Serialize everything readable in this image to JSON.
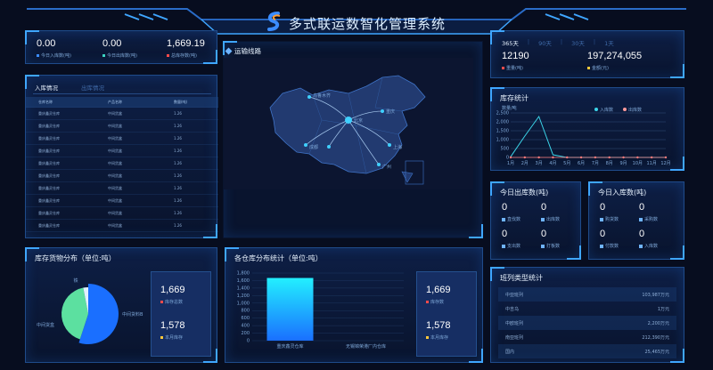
{
  "header": {
    "title": "多式联运数智化管理系统"
  },
  "top_stats": [
    {
      "value": "0.00",
      "label": "今日入库数(吨)",
      "color": "#3b8cff"
    },
    {
      "value": "0.00",
      "label": "今日出库数(吨)",
      "color": "#3bd4c2"
    },
    {
      "value": "1,669.19",
      "label": "总库存数(吨)",
      "color": "#ff4b4b"
    }
  ],
  "inbound": {
    "tabs": [
      "入库情况",
      "出库情况"
    ],
    "headers": [
      "仓库名称",
      "产品名称",
      "数量(吨)"
    ],
    "rows": [
      [
        "重庆鑫灵仓库",
        "中间货盒",
        "1.26"
      ],
      [
        "重庆鑫灵仓库",
        "中间货盒",
        "1.26"
      ],
      [
        "重庆鑫灵仓库",
        "中间货盒",
        "1.26"
      ],
      [
        "重庆鑫灵仓库",
        "中间货盒",
        "1.26"
      ],
      [
        "重庆鑫灵仓库",
        "中间货盒",
        "1.26"
      ],
      [
        "重庆鑫灵仓库",
        "中间货盒",
        "1.26"
      ],
      [
        "重庆鑫灵仓库",
        "中间货盒",
        "1.26"
      ],
      [
        "重庆鑫灵仓库",
        "中间货盒",
        "1.26"
      ],
      [
        "重庆鑫灵仓库",
        "中间货盒",
        "1.26"
      ],
      [
        "重庆鑫灵仓库",
        "中间货盒",
        "1.26"
      ]
    ]
  },
  "transport": {
    "title": "运输线路",
    "cities": [
      "乌鲁木齐",
      "北京",
      "成都",
      "上海",
      "广州",
      "重庆"
    ]
  },
  "period": {
    "tabs": [
      "365天",
      "90天",
      "30天",
      "1天"
    ],
    "weight": "12190",
    "weight_label": "重量(吨)",
    "amount": "197,274,055",
    "amount_label": "金额(元)"
  },
  "stock_stats": {
    "title": "库存统计",
    "legend_in": "入库数",
    "legend_out": "出库数",
    "y_label": "数量/吨"
  },
  "today_out": {
    "title": "今日出库数(吨)",
    "items": [
      {
        "value": "0",
        "label": "直伐数"
      },
      {
        "value": "0",
        "label": "出库数"
      },
      {
        "value": "0",
        "label": "支出数"
      },
      {
        "value": "0",
        "label": "打板数"
      }
    ]
  },
  "today_in": {
    "title": "今日入库数(吨)",
    "items": [
      {
        "value": "0",
        "label": "购货数"
      },
      {
        "value": "0",
        "label": "采购数"
      },
      {
        "value": "0",
        "label": "付款数"
      },
      {
        "value": "0",
        "label": "入库数"
      }
    ]
  },
  "distribution": {
    "title": "库存货物分布（单位:吨）",
    "total": "1,669",
    "total_label": "库存总数",
    "month": "1,578",
    "month_label": "本月库存",
    "slice_labels": [
      "铁",
      "中间货盒",
      "中间货料B"
    ]
  },
  "warehouse": {
    "title": "各仓库分布统计（单位:吨）",
    "total": "1,669",
    "total_label": "库存数",
    "month": "1,578",
    "month_label": "本月库存"
  },
  "route_stats": {
    "title": "班列类型统计",
    "rows": [
      {
        "name": "中亚班列",
        "value": "103,987万元"
      },
      {
        "name": "中吉乌",
        "value": "1万元"
      },
      {
        "name": "中欧班列",
        "value": "2,200万元"
      },
      {
        "name": "南亚班列",
        "value": "212,390万元"
      },
      {
        "name": "国内",
        "value": "25,465万元"
      }
    ]
  },
  "chart_data": [
    {
      "type": "line",
      "title": "库存统计",
      "categories": [
        "1月",
        "2月",
        "3月",
        "4月",
        "5月",
        "6月",
        "7月",
        "8月",
        "9月",
        "10月",
        "11月",
        "12月"
      ],
      "ylim": [
        0,
        2500
      ],
      "yticks": [
        0,
        500,
        1000,
        1500,
        2000,
        2500
      ],
      "series": [
        {
          "name": "入库数",
          "values": [
            40,
            1200,
            2300,
            150,
            0,
            0,
            0,
            0,
            0,
            0,
            0,
            0
          ]
        },
        {
          "name": "出库数",
          "values": [
            0,
            0,
            0,
            0,
            0,
            0,
            0,
            0,
            0,
            0,
            0,
            0
          ]
        }
      ]
    },
    {
      "type": "bar",
      "title": "各仓库分布统计（单位:吨）",
      "categories": [
        "重庆鑫灵仓库",
        "无锡锦荣港厂内仓库"
      ],
      "values": [
        1669,
        0
      ],
      "ylim": [
        0,
        1800
      ],
      "yticks": [
        0,
        200,
        400,
        600,
        800,
        1000,
        1200,
        1400,
        1600,
        1800
      ]
    },
    {
      "type": "pie",
      "title": "库存货物分布（单位:吨）",
      "categories": [
        "中间货料B",
        "中间货盒",
        "铁"
      ],
      "values": [
        55,
        42,
        3
      ],
      "colors": [
        "#1a6fff",
        "#5ce0a0",
        "#e0f0ff"
      ]
    }
  ]
}
